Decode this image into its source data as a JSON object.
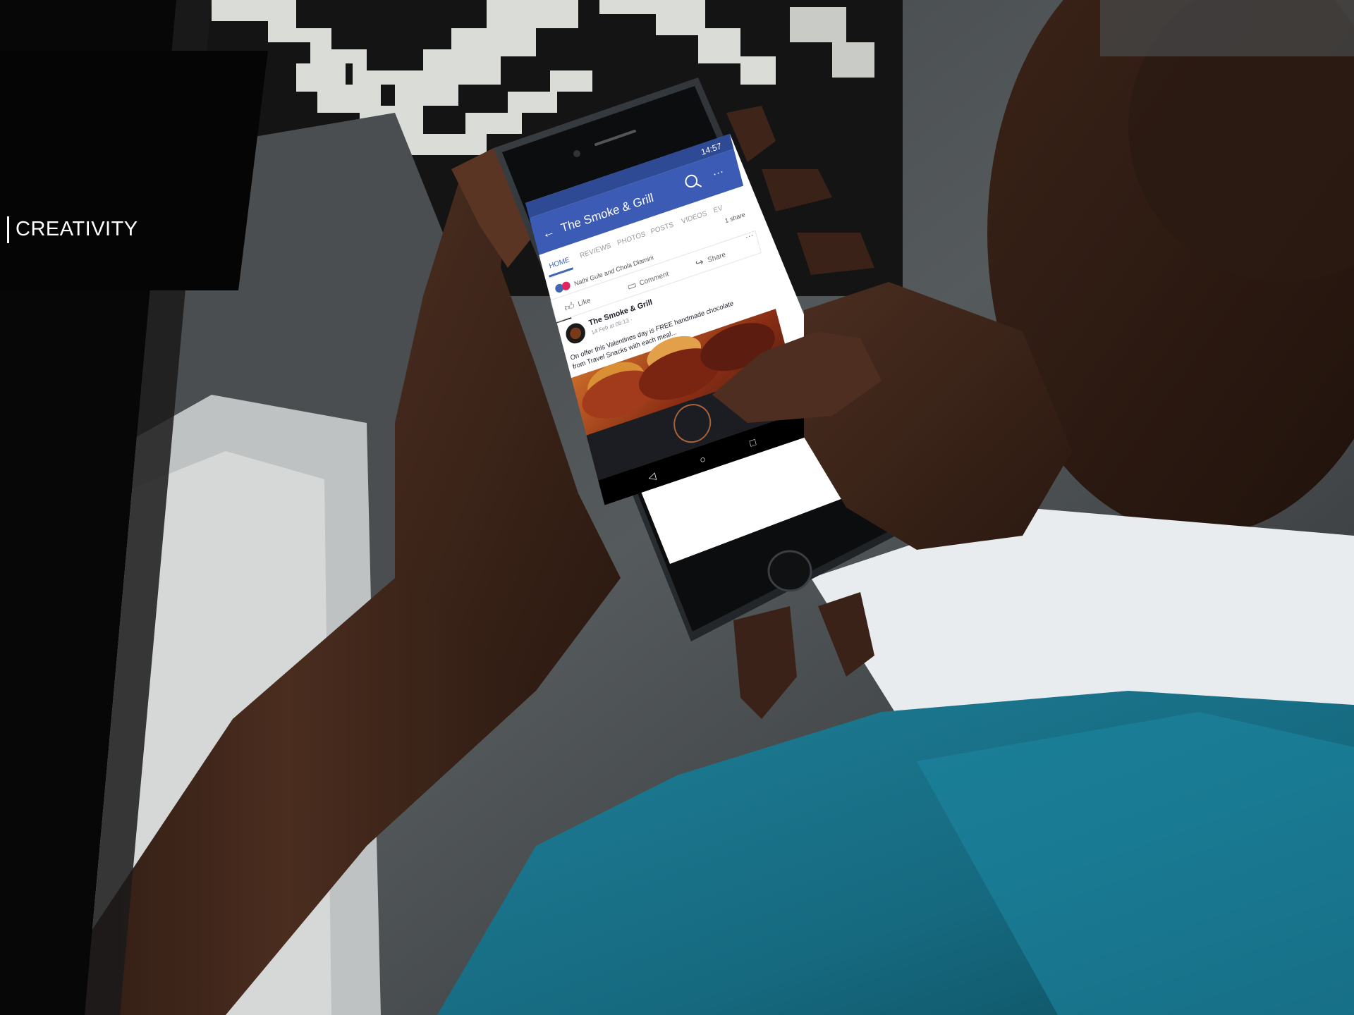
{
  "section_label": "CREATIVITY",
  "phone": {
    "status_time": "14:57",
    "page_title": "The Smoke & Grill",
    "tabs": [
      "HOME",
      "REVIEWS",
      "PHOTOS",
      "POSTS",
      "VIDEOS",
      "EV"
    ],
    "active_tab": "HOME",
    "shares": "1 share",
    "reactions_by": "Nathi Gule and Chola Dlamini",
    "actions": {
      "like": "Like",
      "comment": "Comment",
      "share": "Share"
    },
    "post": {
      "author": "The Smoke & Grill",
      "meta": "14 Feb at 05:13 · ",
      "text_line1": "On offer this Valentines day is FREE handmade chocolate",
      "text_line2": "from Travel Snacks with each meal..."
    }
  },
  "colors": {
    "facebook_blue": "#3b5bb5",
    "tab_active": "#4267b2",
    "panel_black": "#050505",
    "shirt_teal": "#1a6b82"
  },
  "icons": [
    "back-arrow-icon",
    "search-icon",
    "more-icon",
    "like-icon",
    "comment-icon",
    "share-icon",
    "android-back-icon",
    "android-home-icon",
    "android-recent-icon"
  ]
}
